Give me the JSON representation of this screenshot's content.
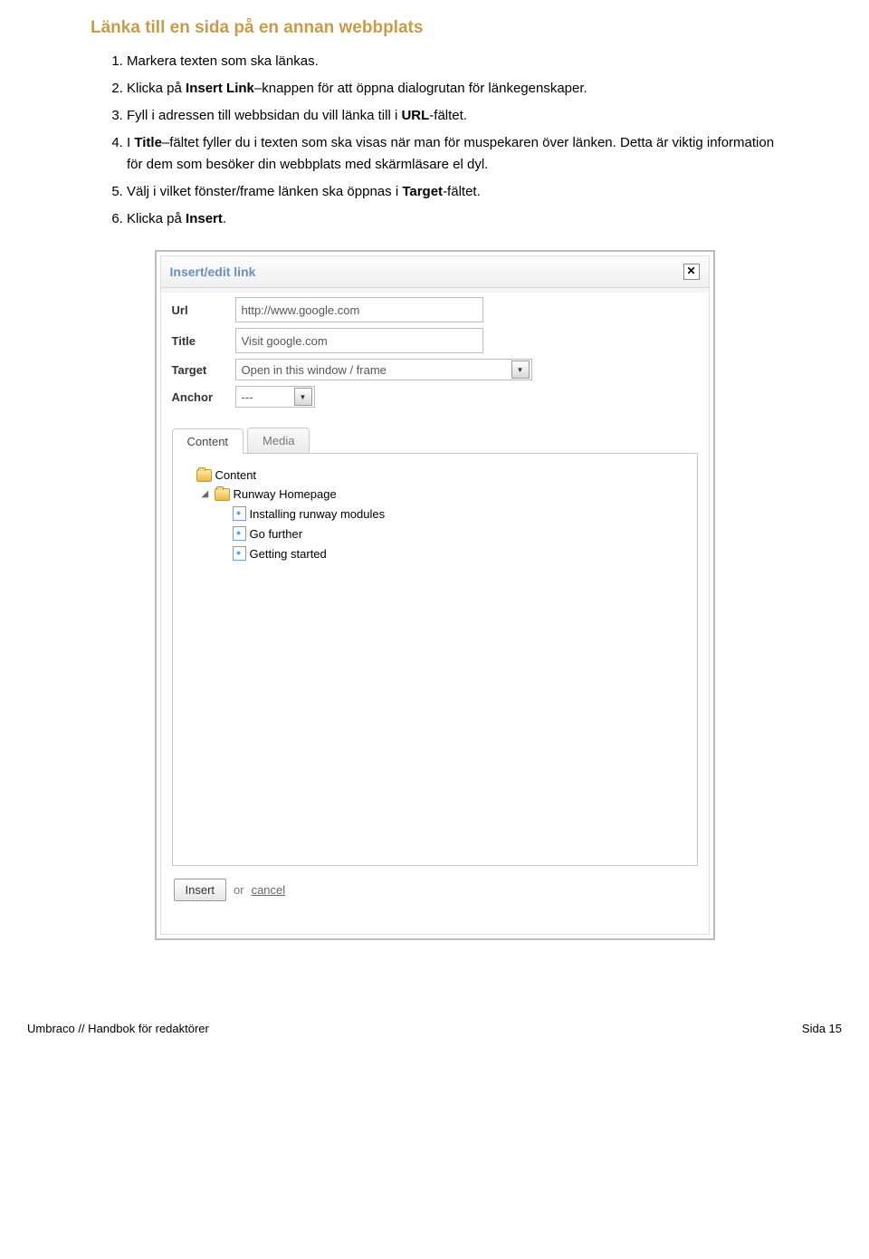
{
  "section_title": "Länka till en sida på en annan webbplats",
  "steps": [
    {
      "prefix": "Markera texten som ska länkas."
    },
    {
      "prefix": "Klicka på ",
      "bold1": "Insert Link",
      "mid": "–knappen för att öppna dialogrutan för länkegenskaper."
    },
    {
      "prefix": "Fyll i adressen till webbsidan du vill länka till i ",
      "bold1": "URL",
      "mid": "-fältet."
    },
    {
      "prefix": "I ",
      "bold1": "Title",
      "mid": "–fältet fyller du i texten som ska visas när man för muspekaren över länken. Detta är viktig information för dem som besöker din webbplats med skärmläsare el dyl."
    },
    {
      "prefix": "Välj i vilket fönster/frame länken ska öppnas i ",
      "bold1": "Target",
      "mid": "-fältet."
    },
    {
      "prefix": "Klicka på ",
      "bold1": "Insert",
      "mid": "."
    }
  ],
  "dialog": {
    "title": "Insert/edit link",
    "labels": {
      "url": "Url",
      "title": "Title",
      "target": "Target",
      "anchor": "Anchor"
    },
    "values": {
      "url": "http://www.google.com",
      "title": "Visit google.com",
      "target": "Open in this window / frame",
      "anchor": "---"
    },
    "tabs": {
      "content": "Content",
      "media": "Media"
    },
    "tree": {
      "root": "Content",
      "home": "Runway Homepage",
      "children": [
        "Installing runway modules",
        "Go further",
        "Getting started"
      ]
    },
    "footer": {
      "insert": "Insert",
      "or": "or",
      "cancel": "cancel"
    }
  },
  "page_footer": {
    "left": "Umbraco // Handbok för redaktörer",
    "right": "Sida 15"
  }
}
